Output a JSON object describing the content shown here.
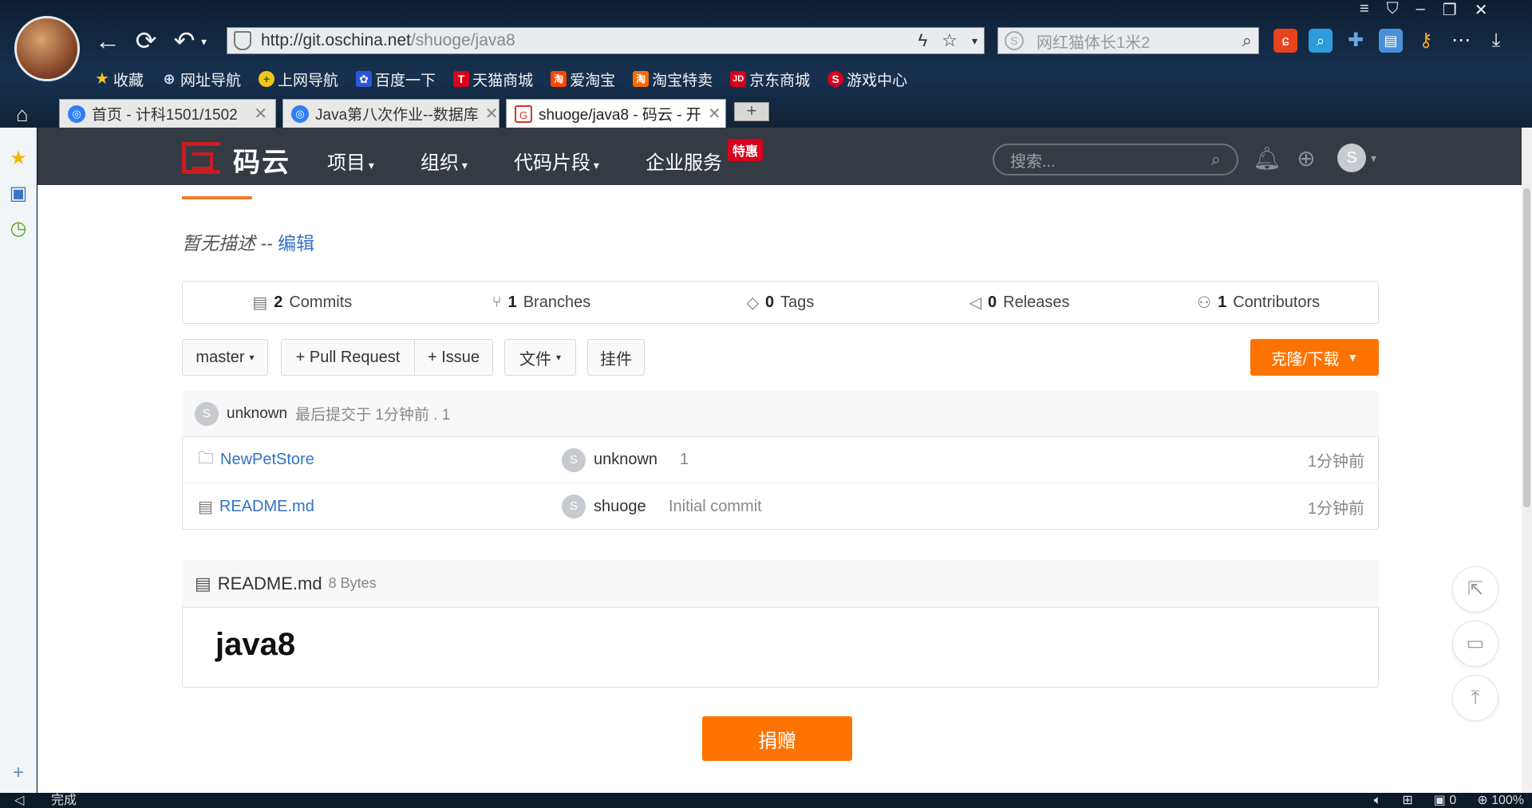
{
  "browser": {
    "address": {
      "host": "http://git.oschina.net",
      "path": "/shuoge/java8"
    },
    "search_placeholder": "网红猫体长1米2",
    "bookmarks": [
      {
        "label": "收藏",
        "icon": "star-icon",
        "color": "#f5c518"
      },
      {
        "label": "网址导航",
        "icon": "globe-icon",
        "color": "#2d7ff9"
      },
      {
        "label": "上网导航",
        "icon": "plus-circle-icon",
        "color": "#5cb85c"
      },
      {
        "label": "百度一下",
        "icon": "baidu-icon",
        "color": "#2d55d8"
      },
      {
        "label": "天猫商城",
        "icon": "tmall-icon",
        "color": "#d9001b",
        "glyph": "T"
      },
      {
        "label": "爱淘宝",
        "icon": "aitaobao-icon",
        "color": "#ff4400",
        "glyph": "淘"
      },
      {
        "label": "淘宝特卖",
        "icon": "taobao-icon",
        "color": "#ff6a00",
        "glyph": "淘"
      },
      {
        "label": "京东商城",
        "icon": "jd-icon",
        "color": "#d9001b",
        "glyph": "JD"
      },
      {
        "label": "游戏中心",
        "icon": "game-icon",
        "color": "#d9001b",
        "glyph": "S"
      }
    ],
    "tabs": [
      {
        "label": "首页 - 计科1501/1502",
        "active": false
      },
      {
        "label": "Java第八次作业--数据库",
        "active": false
      },
      {
        "label": "shuoge/java8 - 码云 - 开",
        "active": true
      }
    ],
    "status_left": "完成",
    "status_right": [
      "0",
      "100%"
    ]
  },
  "site": {
    "logo_text": "码云",
    "nav": [
      "项目",
      "组织",
      "代码片段",
      "企业服务"
    ],
    "badge": "特惠",
    "search_placeholder": "搜索...",
    "user_initial": "S",
    "accent": "#fe7300"
  },
  "repo": {
    "description": "暂无描述",
    "description_sep": " -- ",
    "edit_label": "编辑",
    "stats": [
      {
        "count": "2",
        "label": "Commits",
        "icon": "commit-icon"
      },
      {
        "count": "1",
        "label": "Branches",
        "icon": "branch-icon"
      },
      {
        "count": "0",
        "label": "Tags",
        "icon": "tag-icon"
      },
      {
        "count": "0",
        "label": "Releases",
        "icon": "release-icon"
      },
      {
        "count": "1",
        "label": "Contributors",
        "icon": "contributors-icon"
      }
    ],
    "toolbar": {
      "branch": "master",
      "pull_request": "+ Pull Request",
      "issue": "+ Issue",
      "files": "文件",
      "attachments": "挂件",
      "clone": "克隆/下载"
    },
    "last_commit": {
      "avatar": "S",
      "author": "unknown",
      "text": "最后提交于 1分钟前 . 1"
    },
    "files": [
      {
        "name": "NewPetStore",
        "type": "folder",
        "avatar": "S",
        "author": "unknown",
        "message": "1",
        "time": "1分钟前"
      },
      {
        "name": "README.md",
        "type": "file",
        "avatar": "S",
        "author": "shuoge",
        "message": "Initial commit",
        "time": "1分钟前"
      }
    ],
    "readme": {
      "filename": "README.md",
      "size": "8 Bytes",
      "heading": "java8"
    },
    "donate": "捐赠"
  }
}
